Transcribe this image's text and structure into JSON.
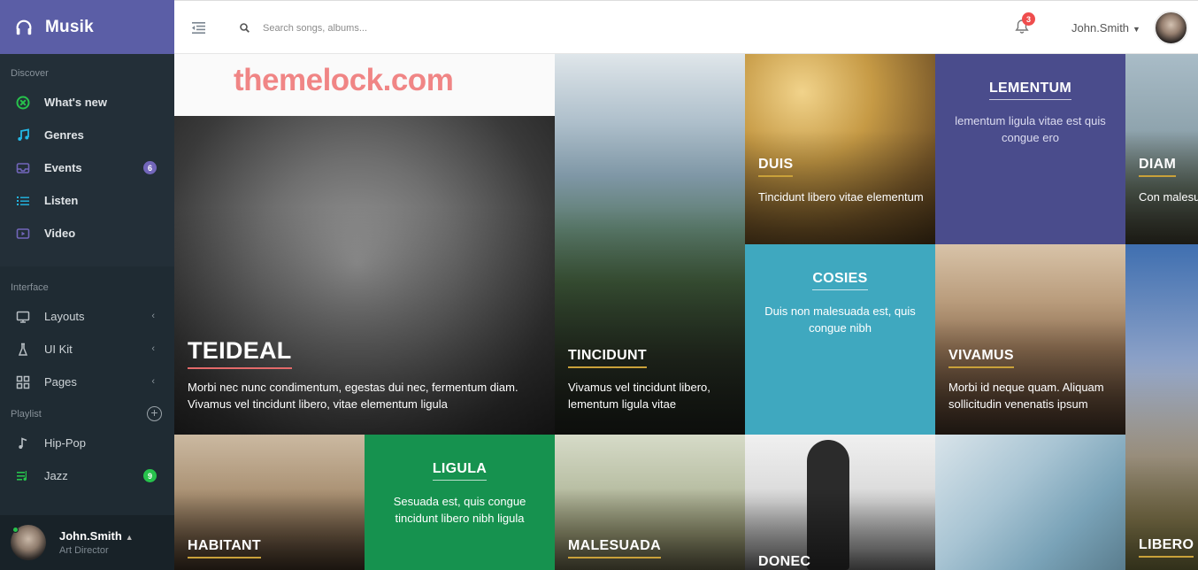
{
  "app": {
    "name": "Musik"
  },
  "sidebar": {
    "discover_title": "Discover",
    "discover_items": [
      {
        "label": "What's new"
      },
      {
        "label": "Genres"
      },
      {
        "label": "Events",
        "badge": "6"
      },
      {
        "label": "Listen"
      },
      {
        "label": "Video"
      }
    ],
    "interface_title": "Interface",
    "interface_items": [
      {
        "label": "Layouts"
      },
      {
        "label": "UI Kit"
      },
      {
        "label": "Pages"
      }
    ],
    "playlist_title": "Playlist",
    "playlist_items": [
      {
        "label": "Hip-Pop"
      },
      {
        "label": "Jazz",
        "badge": "9"
      }
    ],
    "user": {
      "name": "John.Smith",
      "role": "Art Director"
    }
  },
  "header": {
    "search_placeholder": "Search songs, albums...",
    "notification_count": "3",
    "user_name": "John.Smith"
  },
  "watermark": "themelock.com",
  "tiles": [
    {
      "title": "TEIDEAL",
      "desc": "Morbi nec nunc condimentum, egestas dui nec, fermentum diam. Vivamus vel tincidunt libero, vitae elementum ligula"
    },
    {
      "title": "TINCIDUNT",
      "desc": "Vivamus vel tincidunt libero, lementum ligula vitae"
    },
    {
      "title": "DUIS",
      "desc": "Tincidunt libero vitae elementum"
    },
    {
      "title": "LEMENTUM",
      "desc": "lementum ligula vitae est quis congue ero"
    },
    {
      "title": "DIAM",
      "desc": "Con malesu congue nib"
    },
    {
      "title": "COSIES",
      "desc": "Duis non malesuada est, quis congue nibh"
    },
    {
      "title": "VIVAMUS",
      "desc": "Morbi id neque quam. Aliquam sollicitudin venenatis ipsum"
    },
    {
      "title": "HABITANT"
    },
    {
      "title": "LIGULA",
      "desc": "Sesuada est, quis congue tincidunt libero nibh ligula"
    },
    {
      "title": "MALESUADA"
    },
    {
      "title": "DONEC"
    },
    {
      "title": "LIBERO"
    }
  ],
  "colors": {
    "brand": "#5b5ea6",
    "sidebar_bg": "#1f2b33",
    "tile_blue": "#3fa8bf",
    "tile_indigo": "#4a4c8c",
    "tile_green": "#16924f",
    "badge_red": "#ef4d4d"
  }
}
